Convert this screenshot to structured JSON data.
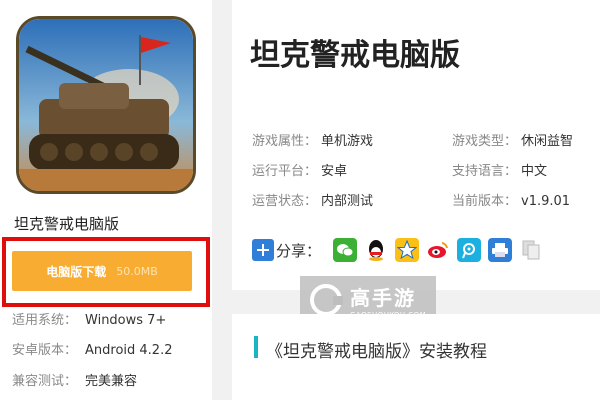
{
  "app": {
    "name": "坦克警戒电脑版",
    "download_label": "电脑版下载",
    "download_size": "50.0MB"
  },
  "specs": [
    {
      "key": "适用系统：",
      "value": "Windows 7+"
    },
    {
      "key": "安卓版本：",
      "value": "Android 4.2.2"
    },
    {
      "key": "兼容测试：",
      "value": "完美兼容"
    }
  ],
  "attributes": [
    {
      "key": "游戏属性：",
      "value": "单机游戏"
    },
    {
      "key": "游戏类型：",
      "value": "休闲益智"
    },
    {
      "key": "运行平台：",
      "value": "安卓"
    },
    {
      "key": "支持语言：",
      "value": "中文"
    },
    {
      "key": "运营状态：",
      "value": "内部测试"
    },
    {
      "key": "当前版本：",
      "value": "v1.9.01"
    }
  ],
  "share": {
    "label": "分享：",
    "icons": [
      "wechat-icon",
      "qq-icon",
      "qzone-icon",
      "weibo-icon",
      "tencent-weibo-icon",
      "print-icon",
      "copy-icon"
    ]
  },
  "watermark": {
    "main": "高手游",
    "sub": "GAOSHOUYOU.COM"
  },
  "section": {
    "title": "《坦克警戒电脑版》安装教程"
  },
  "colors": {
    "download": "#f8ac31",
    "highlight_frame": "#e00d0d",
    "section_bar": "#1bb4c4",
    "share_plus": "#2f7fd8"
  }
}
